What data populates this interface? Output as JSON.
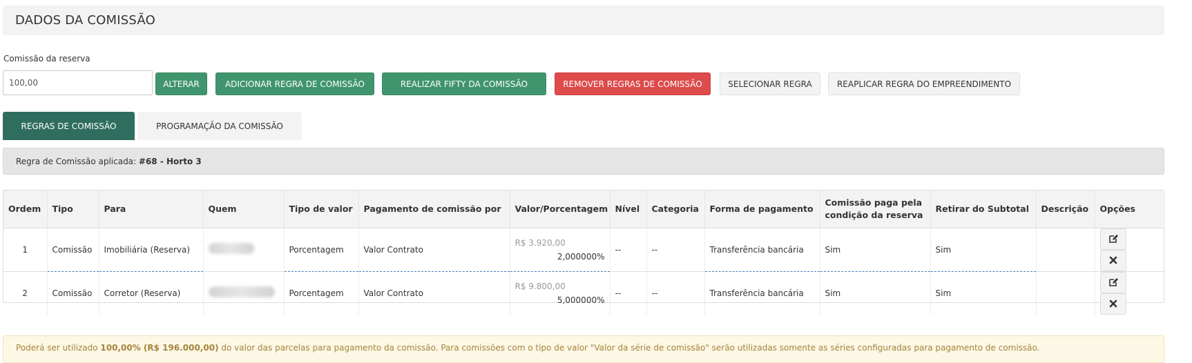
{
  "header": {
    "title": "DADOS DA COMISSÃO"
  },
  "commission": {
    "label": "Comissão da reserva",
    "value": "100,00"
  },
  "buttons": {
    "alterar": "ALTERAR",
    "adicionar": "ADICIONAR REGRA DE COMISSÃO",
    "fifty": "REALIZAR FIFTY DA COMISSÃO",
    "remover": "REMOVER REGRAS DE COMISSÃO",
    "selecionar": "SELECIONAR REGRA",
    "reaplicar": "REAPLICAR REGRA DO EMPREENDIMENTO"
  },
  "tabs": [
    {
      "label": "REGRAS DE COMISSÃO",
      "active": true
    },
    {
      "label": "PROGRAMAÇÃO DA COMISSÃO",
      "active": false
    }
  ],
  "rule": {
    "prefix": "Regra de Comissão aplicada:",
    "name": "#68 - Horto 3"
  },
  "table": {
    "headers": [
      "Ordem",
      "Tipo",
      "Para",
      "Quem",
      "Tipo de valor",
      "Pagamento de comissão por",
      "Valor/Porcentagem",
      "Nível",
      "Categoria",
      "Forma de pagamento",
      "Comissão paga pela condição da reserva",
      "Retirar do Subtotal",
      "Descrição",
      "Opções"
    ],
    "rows": [
      {
        "ordem": "1",
        "tipo": "Comissão",
        "para": "Imobiliária (Reserva)",
        "tipo_valor": "Porcentagem",
        "pagamento": "Valor Contrato",
        "valor": "R$ 3.920,00",
        "porcentagem": "2,000000%",
        "nivel": "--",
        "categoria": "--",
        "forma": "Transferência bancária",
        "condicao": "Sim",
        "subtotal": "Sim",
        "descricao": ""
      },
      {
        "ordem": "2",
        "tipo": "Comissão",
        "para": "Corretor (Reserva)",
        "tipo_valor": "Porcentagem",
        "pagamento": "Valor Contrato",
        "valor": "R$ 9.800,00",
        "porcentagem": "5,000000%",
        "nivel": "--",
        "categoria": "--",
        "forma": "Transferência bancária",
        "condicao": "Sim",
        "subtotal": "Sim",
        "descricao": ""
      }
    ]
  },
  "icons": {
    "edit": "edit-icon",
    "delete": "close-icon"
  },
  "notice": {
    "part1": "Poderá ser utilizado",
    "highlight": "100,00% (R$ 196.000,00)",
    "part2": "do valor das parcelas para pagamento da comissão. Para comissões com o tipo de valor \"Valor da série de comissão\" serão utilizadas somente as séries configuradas para pagamento de comissão."
  },
  "colors": {
    "green": "#41956e",
    "dark_green": "#2f6e5e",
    "red": "#dd4b4b",
    "notice_text": "#a4853c"
  }
}
